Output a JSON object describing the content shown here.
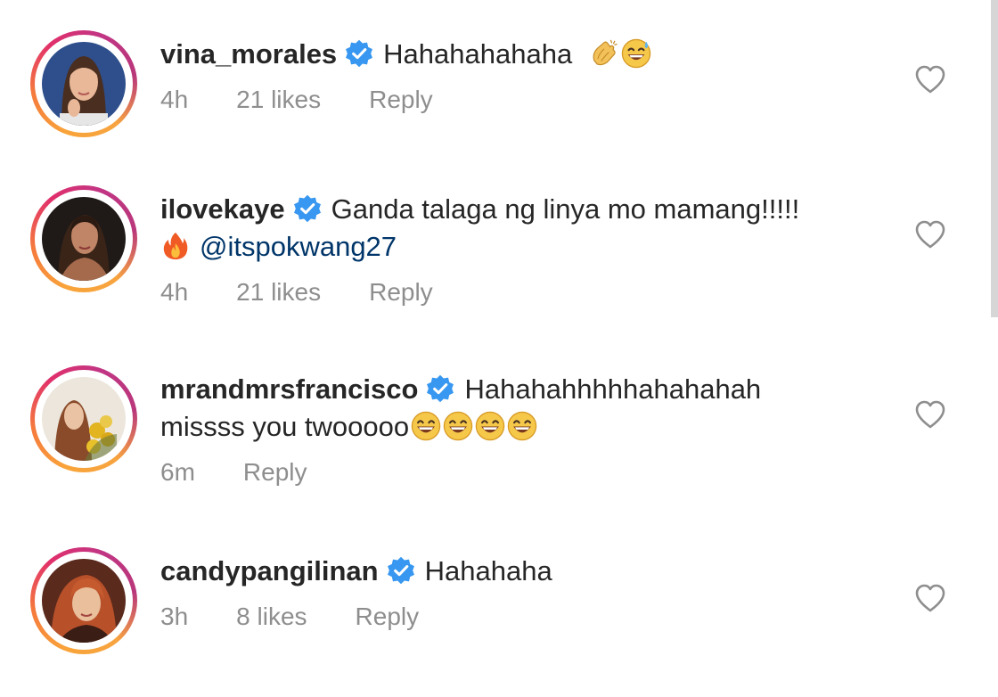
{
  "comments": [
    {
      "username": "vina_morales",
      "lines": [
        "Hahahahahaha"
      ],
      "emojis": [
        "clapping-hands-icon",
        "grinning-sweat-icon"
      ],
      "time": "4h",
      "likes": "21 likes",
      "reply": "Reply"
    },
    {
      "username": "ilovekaye",
      "lines": [
        "Ganda talaga ng linya mo mamang!!!!!"
      ],
      "mention": "@itspokwang27",
      "emojis": [
        "fire-icon"
      ],
      "time": "4h",
      "likes": "21 likes",
      "reply": "Reply"
    },
    {
      "username": "mrandmrsfrancisco",
      "lines": [
        "Hahahahhhhhahahahah",
        "missss you twooooo"
      ],
      "emojis": [
        "laughing-face-icon",
        "laughing-face-icon",
        "laughing-face-icon",
        "laughing-face-icon"
      ],
      "time": "6m",
      "reply": "Reply"
    },
    {
      "username": "candypangilinan",
      "lines": [
        "Hahahaha"
      ],
      "time": "3h",
      "likes": "8 likes",
      "reply": "Reply"
    }
  ],
  "colors": {
    "verified": "#3897f0",
    "meta": "#8e8e8e",
    "mention": "#003569",
    "text": "#262626"
  }
}
